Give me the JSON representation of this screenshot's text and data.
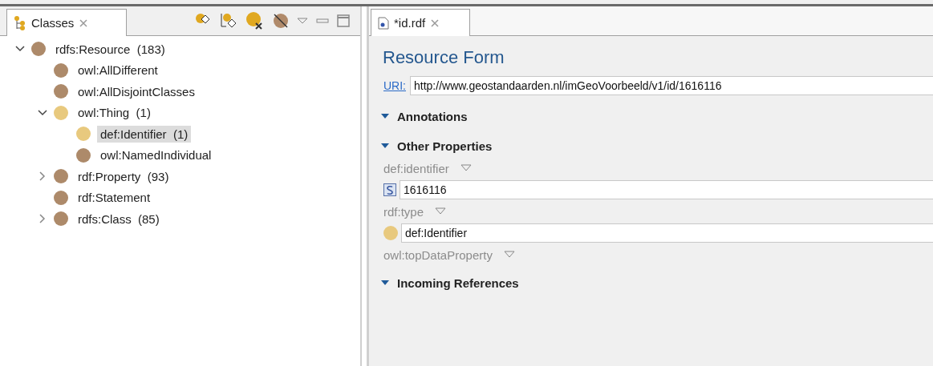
{
  "classes_view": {
    "tab": {
      "label": "Classes",
      "selected": true
    },
    "tree": [
      {
        "label": "rdfs:Resource",
        "count": "(183)",
        "color": "#ad8a6a",
        "kind": "folder",
        "expanded": true,
        "selected": false,
        "children": [
          {
            "label": "owl:AllDifferent",
            "color": "#ad8a6a",
            "kind": "leaf",
            "selected": false
          },
          {
            "label": "owl:AllDisjointClasses",
            "color": "#ad8a6a",
            "kind": "leaf",
            "selected": false
          },
          {
            "label": "owl:Thing",
            "count": "(1)",
            "color": "#e8c97e",
            "kind": "folder",
            "expanded": true,
            "selected": false,
            "children": [
              {
                "label": "def:Identifier",
                "count": "(1)",
                "color": "#e8c97e",
                "kind": "leaf",
                "selected": true
              },
              {
                "label": "owl:NamedIndividual",
                "color": "#ad8a6a",
                "kind": "leaf",
                "selected": false
              }
            ]
          },
          {
            "label": "rdf:Property",
            "count": "(93)",
            "color": "#ad8a6a",
            "kind": "folder",
            "expanded": false,
            "selected": false
          },
          {
            "label": "rdf:Statement",
            "color": "#ad8a6a",
            "kind": "leaf",
            "selected": false
          },
          {
            "label": "rdfs:Class",
            "count": "(85)",
            "color": "#ad8a6a",
            "kind": "folder",
            "expanded": false,
            "selected": false
          }
        ]
      }
    ]
  },
  "editor": {
    "tab": {
      "label": "*id.rdf",
      "selected": true
    },
    "title": "Resource Form",
    "uri": {
      "label": "URI:",
      "value": "http://www.geostandaarden.nl/imGeoVoorbeeld/v1/id/1616116"
    },
    "sections": [
      {
        "title": "Annotations",
        "expanded": true
      },
      {
        "title": "Other Properties",
        "expanded": true,
        "properties": [
          {
            "name": "def:identifier",
            "values": [
              {
                "kind": "literal",
                "value": "1616116"
              }
            ]
          },
          {
            "name": "rdf:type",
            "values": [
              {
                "kind": "resource",
                "color": "#e8c97e",
                "value": "def:Identifier"
              }
            ]
          },
          {
            "name": "owl:topDataProperty"
          }
        ]
      },
      {
        "title": "Incoming References",
        "expanded": true
      }
    ]
  }
}
